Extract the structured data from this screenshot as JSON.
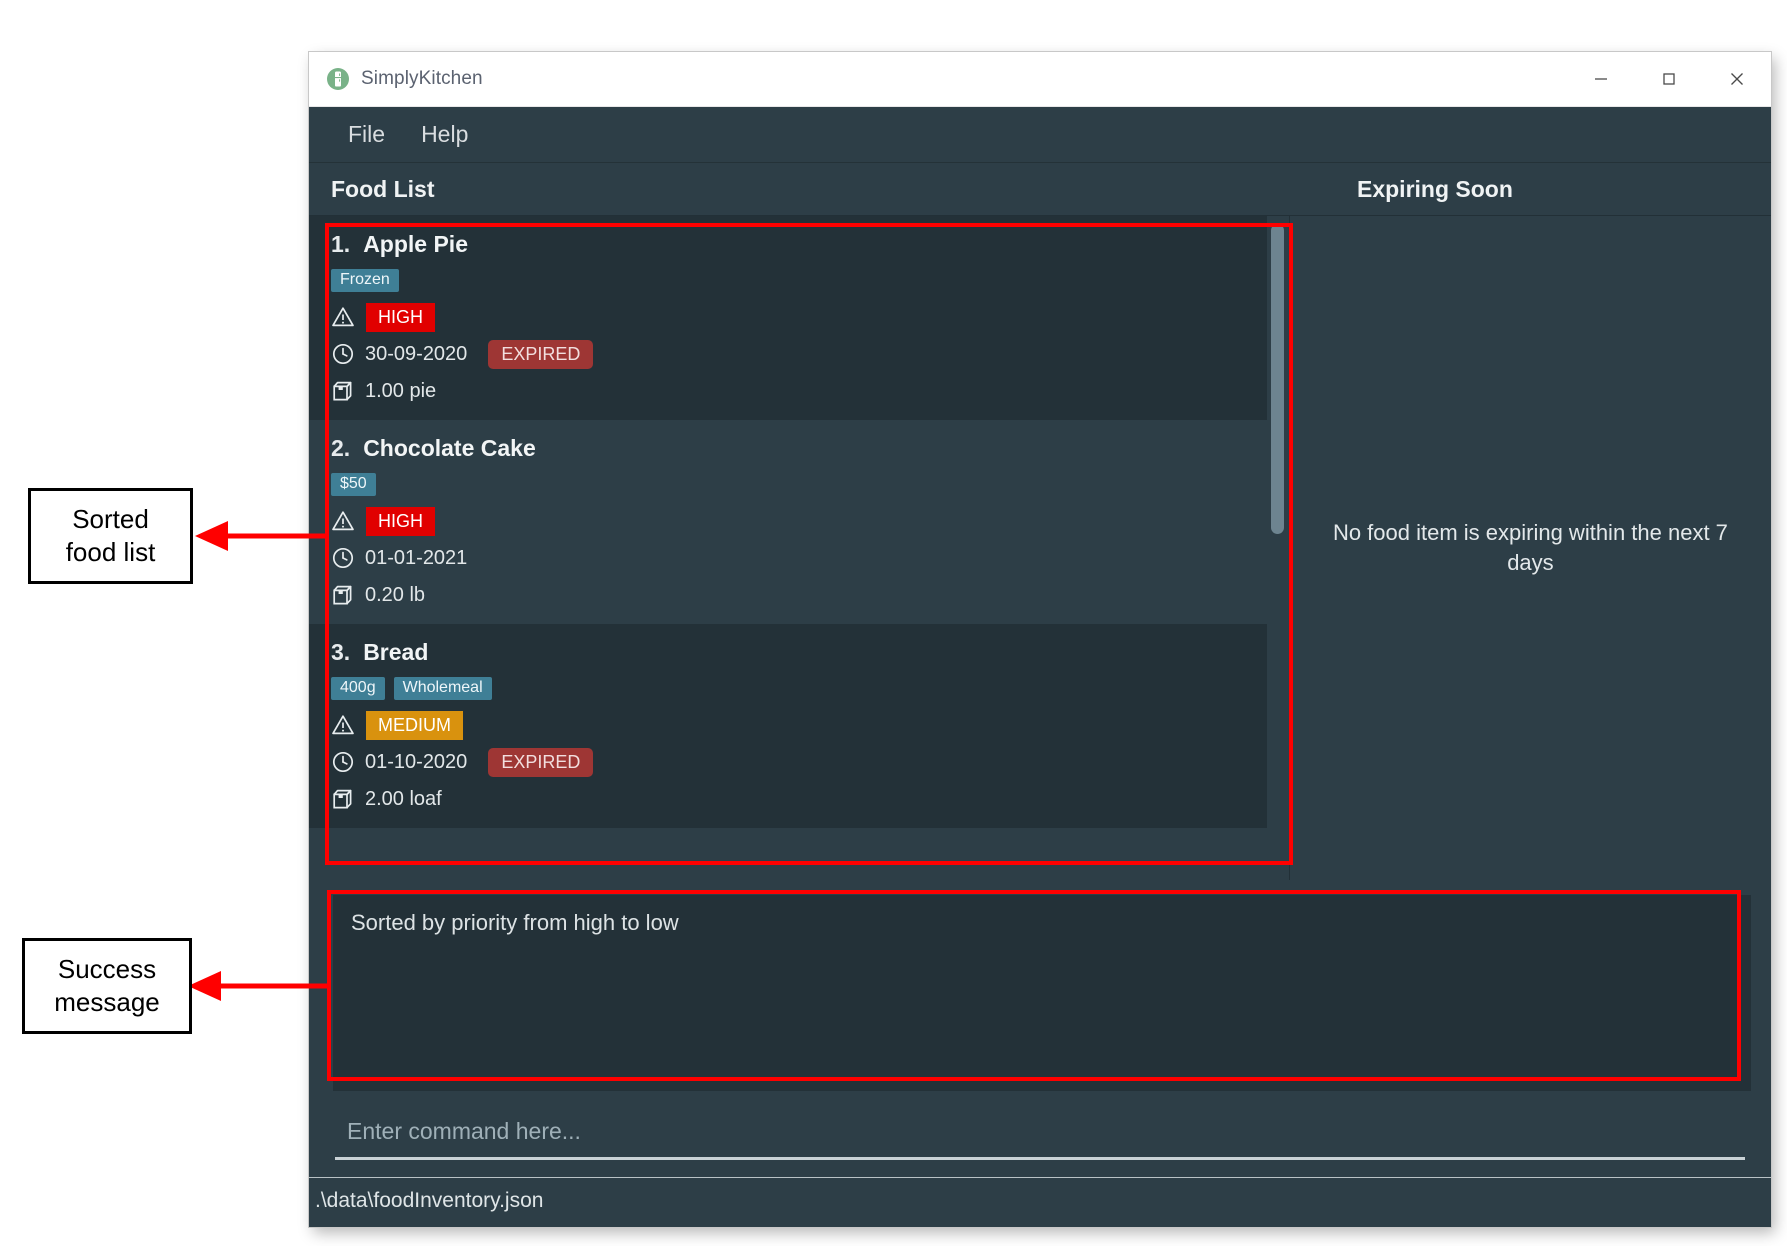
{
  "window": {
    "title": "SimplyKitchen",
    "app_icon": "fridge-icon",
    "controls": {
      "minimize": "minimize-icon",
      "maximize": "maximize-icon",
      "close": "close-icon"
    }
  },
  "menu": {
    "items": [
      {
        "label": "File"
      },
      {
        "label": "Help"
      }
    ]
  },
  "panels": {
    "food_list_title": "Food List",
    "expiring_title": "Expiring Soon"
  },
  "food_list": {
    "items": [
      {
        "index": "1.",
        "name": "Apple Pie",
        "tags": [
          "Frozen"
        ],
        "priority": "HIGH",
        "priority_level": "HIGH",
        "date": "30-09-2020",
        "expired_label": "EXPIRED",
        "is_expired": true,
        "quantity": "1.00 pie"
      },
      {
        "index": "2.",
        "name": "Chocolate Cake",
        "tags": [
          "$50"
        ],
        "priority": "HIGH",
        "priority_level": "HIGH",
        "date": "01-01-2021",
        "expired_label": "",
        "is_expired": false,
        "quantity": "0.20 lb"
      },
      {
        "index": "3.",
        "name": "Bread",
        "tags": [
          "400g",
          "Wholemeal"
        ],
        "priority": "MEDIUM",
        "priority_level": "MEDIUM",
        "date": "01-10-2020",
        "expired_label": "EXPIRED",
        "is_expired": true,
        "quantity": "2.00 loaf"
      }
    ]
  },
  "expiring_soon": {
    "empty_message": "No food item is expiring within the next 7 days"
  },
  "result": {
    "message": "Sorted by priority from high to low"
  },
  "command": {
    "value": "",
    "placeholder": "Enter command here..."
  },
  "status_bar": {
    "path": ".\\data\\foodInventory.json"
  },
  "annotations": [
    {
      "id": "sorted-food-list",
      "label": "Sorted\nfood list"
    },
    {
      "id": "success-message",
      "label": "Success\nmessage"
    }
  ],
  "colors": {
    "app_background": "#2d3e47",
    "card_alt_background": "#233138",
    "tag": "#3f7f96",
    "priority_high": "#e10000",
    "priority_medium": "#d9920e",
    "expired": "#9e3634",
    "annotation": "#ff0000",
    "accent_green": "#6aab78"
  }
}
